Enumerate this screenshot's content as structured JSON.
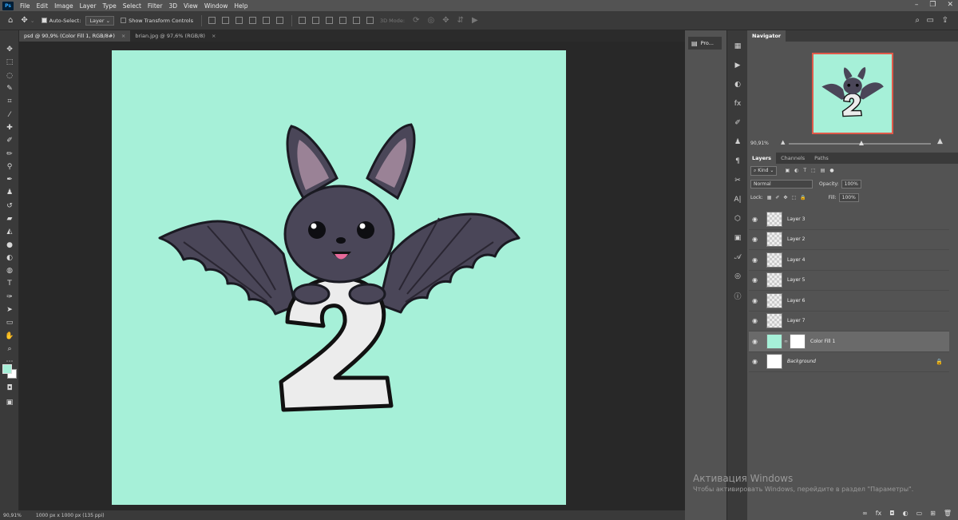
{
  "menubar": {
    "app_icon": "Ps",
    "items": [
      "File",
      "Edit",
      "Image",
      "Layer",
      "Type",
      "Select",
      "Filter",
      "3D",
      "View",
      "Window",
      "Help"
    ]
  },
  "options": {
    "auto_select_label": "Auto-Select:",
    "auto_select_value": "Layer",
    "show_transform_label": "Show Transform Controls",
    "mode_3d_label": "3D Mode:"
  },
  "tabs": [
    {
      "label": "psd @ 90,9% (Color Fill 1, RGB/8#)",
      "close": "×"
    },
    {
      "label": "brian.jpg @ 97,6% (RGB/8)",
      "close": "×"
    }
  ],
  "status": {
    "zoom": "90,91%",
    "doc_info": "1000 px x 1000 px (135 ppi)"
  },
  "properties_label": "Pro...",
  "navigator": {
    "tab": "Navigator",
    "zoom": "90,91%"
  },
  "layers_panel": {
    "tabs": [
      "Layers",
      "Channels",
      "Paths"
    ],
    "kind_label": "Kind",
    "blend_mode": "Normal",
    "opacity_label": "Opacity:",
    "opacity_value": "100%",
    "lock_label": "Lock:",
    "fill_label": "Fill:",
    "fill_value": "100%",
    "layers": [
      {
        "name": "Layer 3"
      },
      {
        "name": "Layer 2"
      },
      {
        "name": "Layer 4"
      },
      {
        "name": "Layer 5"
      },
      {
        "name": "Layer 6"
      },
      {
        "name": "Layer 7"
      },
      {
        "name": "Color Fill 1"
      },
      {
        "name": "Background"
      }
    ]
  },
  "watermark": {
    "title": "Активация Windows",
    "subtitle": "Чтобы активировать Windows, перейдите в раздел \"Параметры\"."
  },
  "colors": {
    "canvas_fill": "#a6f0d8",
    "bat_body": "#4a4658",
    "ear_inner": "#9a8296"
  }
}
